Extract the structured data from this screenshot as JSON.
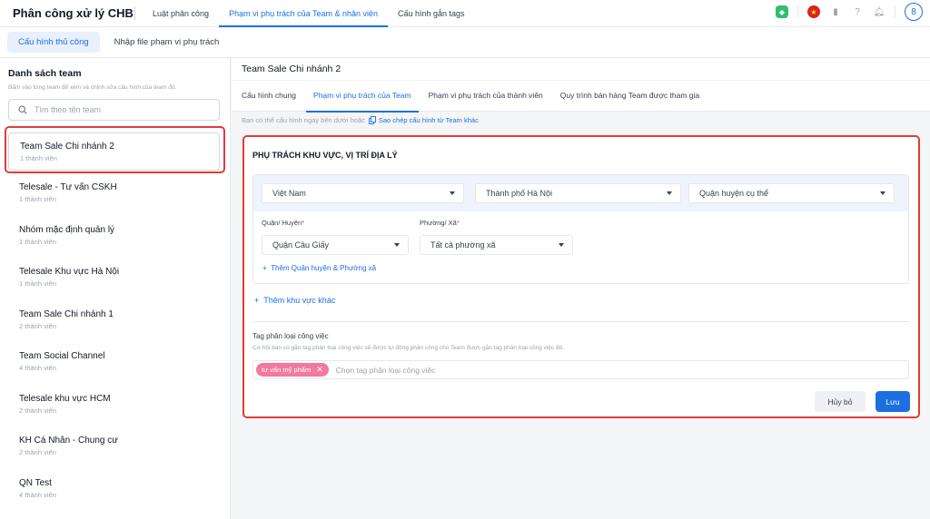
{
  "header": {
    "app_title": "Phân công xử lý CHB",
    "nav": [
      "Luật phân công",
      "Phạm vi phụ trách của Team & nhân viên",
      "Cấu hình gắn tags"
    ],
    "active_nav": 1,
    "icons": [
      "plugin-icon",
      "vietnam-flag-icon",
      "book-icon",
      "help-icon",
      "bell-icon",
      "user-avatar-icon"
    ]
  },
  "subnav": [
    "Cấu hình thủ công",
    "Nhập file phạm vi phụ trách"
  ],
  "sidebar": {
    "title": "Danh sách team",
    "hint": "Bấm vào từng team để xem và chỉnh sửa cấu hình của team đó.",
    "search_placeholder": "Tìm theo tên team",
    "teams": [
      {
        "name": "Team Sale Chi nhánh 2",
        "members": "1 thành viên"
      },
      {
        "name": "Telesale - Tư vấn CSKH",
        "members": "1 thành viên"
      },
      {
        "name": "Nhóm mặc định quản lý",
        "members": "1 thành viên"
      },
      {
        "name": "Telesale Khu vực Hà Nội",
        "members": "1 thành viên"
      },
      {
        "name": "Team Sale Chi nhánh 1",
        "members": "2 thành viên"
      },
      {
        "name": "Team Social Channel",
        "members": "4 thành viên"
      },
      {
        "name": "Telesale khu vực HCM",
        "members": "2 thành viên"
      },
      {
        "name": "KH Cá Nhân - Chung cư",
        "members": "2 thành viên"
      },
      {
        "name": "QN Test",
        "members": "4 thành viên"
      }
    ]
  },
  "main": {
    "title": "Team Sale Chi nhánh 2",
    "tabs": [
      "Cấu hình chung",
      "Phạm vi phụ trách của Team",
      "Phạm vi phụ trách của thành viên",
      "Quy trình bán hàng Team được tham gia"
    ],
    "active_tab": 1,
    "hint_text": "Bạn có thể cấu hình ngay bên dưới hoặc",
    "copy_link": "Sao chép cấu hình từ Team khác",
    "card": {
      "title": "PHỤ TRÁCH KHU VỰC, VỊ TRÍ ĐỊA LÝ",
      "country": "Việt Nam",
      "city": "Thành phố Hà Nội",
      "district_mode": "Quận huyện cụ thể",
      "district_label": "Quận/ Huyện",
      "ward_label": "Phường/ Xã",
      "district_value": "Quận Cầu Giấy",
      "ward_value": "Tất cả phường xã",
      "add_district_link": "Thêm Quận huyện & Phường xã",
      "add_region_link": "Thêm khu vực khác",
      "tag_title": "Tag phân loại công việc",
      "tag_hint": "Cơ hội bán có gắn tag phân loại công việc sẽ được tự động phân công cho Team được gắn tag phân loại công việc đó.",
      "tag_chip": "tư vấn mỹ phẩm",
      "tag_placeholder": "Chọn tag phân loại công việc",
      "cancel_label": "Hủy bỏ",
      "save_label": "Lưu"
    }
  },
  "colors": {
    "primary": "#1d6fe0",
    "highlight_border": "#e23b3b",
    "chip": "#f17a9e"
  }
}
